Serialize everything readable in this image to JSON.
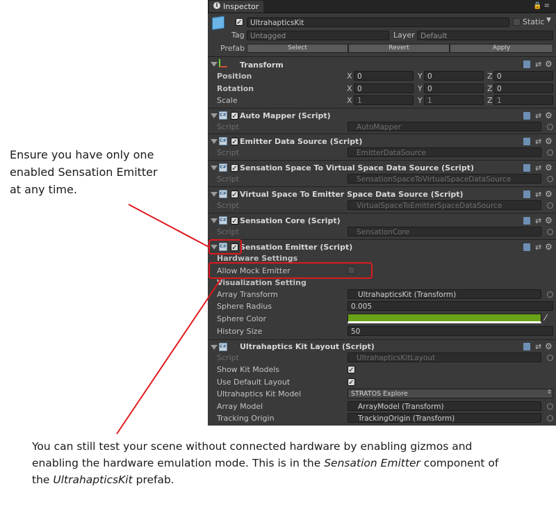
{
  "annotations": {
    "left_note": "Ensure you have only one enabled Sensation Emitter at any time.",
    "bottom_note_parts": {
      "p1": "You can still test your scene without connected hardware by enabling gizmos and enabling the hardware emulation mode. This is in the ",
      "p2": "Sensation Emitter",
      "p3": " component of the ",
      "p4": "UltrahapticsKit",
      "p5": " prefab."
    },
    "highlight_color": "#e0191f"
  },
  "inspector": {
    "tab_label": "Inspector",
    "object_name": "UltrahapticsKit",
    "static_label": "Static",
    "tag_label": "Tag",
    "tag_value": "Untagged",
    "layer_label": "Layer",
    "layer_value": "Default",
    "prefab_label": "Prefab",
    "prefab_buttons": {
      "select": "Select",
      "revert": "Revert",
      "apply": "Apply"
    },
    "transform": {
      "title": "Transform",
      "rows": [
        {
          "label": "Position",
          "x": "0",
          "y": "0",
          "z": "0"
        },
        {
          "label": "Rotation",
          "x": "0",
          "y": "0",
          "z": "0"
        },
        {
          "label": "Scale",
          "x": "1",
          "y": "1",
          "z": "1"
        }
      ],
      "axis": {
        "x": "X",
        "y": "Y",
        "z": "Z"
      }
    },
    "script_label": "Script",
    "components": {
      "auto_mapper": {
        "title": "Auto Mapper (Script)",
        "script": "AutoMapper"
      },
      "emitter_data_source": {
        "title": "Emitter Data Source (Script)",
        "script": "EmitterDataSource"
      },
      "sensation_space": {
        "title": "Sensation Space To Virtual Space Data Source (Script)",
        "script": "SensationSpaceToVirtualSpaceDataSource"
      },
      "virtual_space": {
        "title": "Virtual Space To Emitter Space Data Source (Script)",
        "script": "VirtualSpaceToEmitterSpaceDataSource"
      },
      "sensation_core": {
        "title": "Sensation Core (Script)",
        "script": "SensationCore"
      },
      "sensation_emitter": {
        "title": "Sensation Emitter (Script)",
        "hardware_settings": "Hardware Settings",
        "allow_mock_emitter": "Allow Mock Emitter",
        "visualization_setting": "Visualization Setting",
        "array_transform_label": "Array Transform",
        "array_transform_value": "UltrahapticsKit (Transform)",
        "sphere_radius_label": "Sphere Radius",
        "sphere_radius_value": "0.005",
        "sphere_color_label": "Sphere Color",
        "sphere_color_value": "#6aa317",
        "history_size_label": "History Size",
        "history_size_value": "50"
      },
      "kit_layout": {
        "title": "Ultrahaptics Kit Layout (Script)",
        "script": "UltrahapticsKitLayout",
        "show_kit_models": "Show Kit Models",
        "use_default_layout": "Use Default Layout",
        "kit_model_label": "Ultrahaptics Kit Model",
        "kit_model_value": "STRATOS Explore",
        "array_model_label": "Array Model",
        "array_model_value": "ArrayModel (Transform)",
        "tracking_origin_label": "Tracking Origin",
        "tracking_origin_value": "TrackingOrigin (Transform)"
      }
    }
  }
}
